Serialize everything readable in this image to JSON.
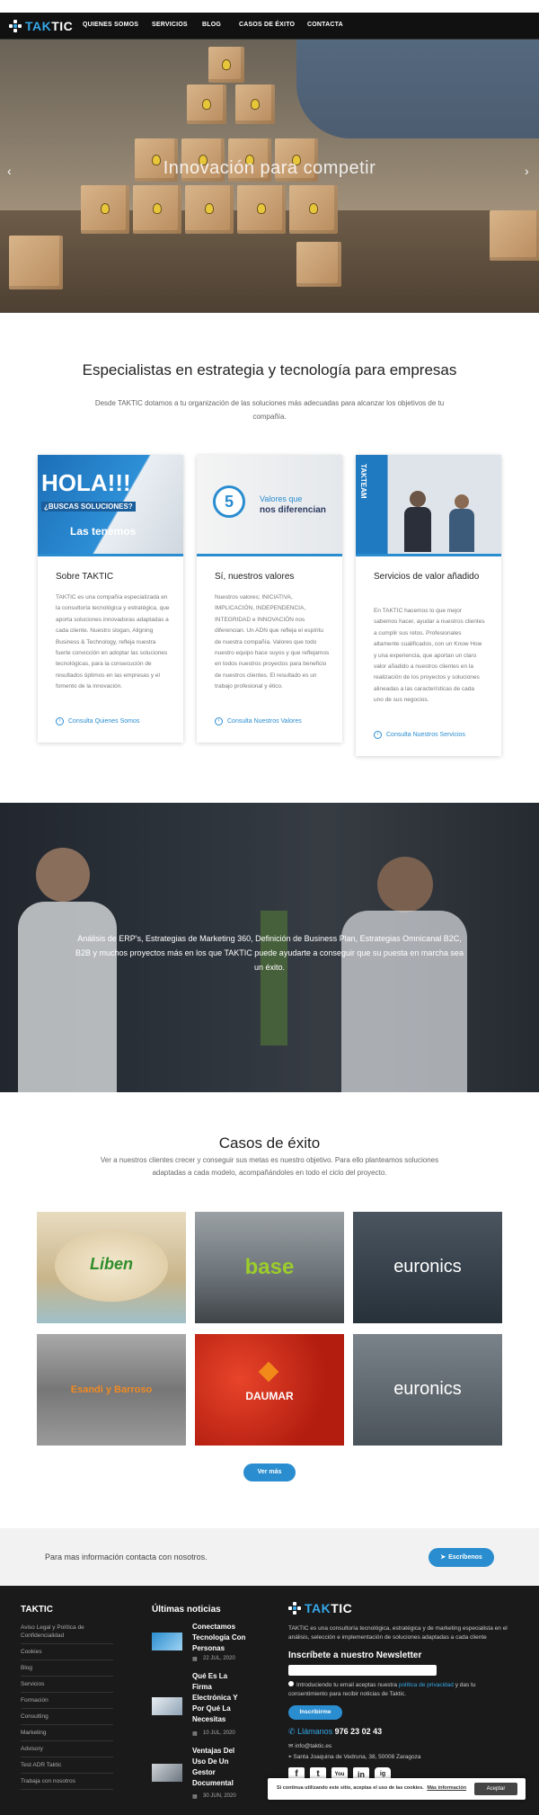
{
  "nav": {
    "brand_a": "TAK",
    "brand_b": "TIC",
    "items": [
      "QUIENES SOMOS",
      "SERVICIOS",
      "BLOG",
      "CASOS DE ÉXITO",
      "CONTACTA"
    ]
  },
  "hero": {
    "title": "Innovación para competir",
    "prev": "‹",
    "next": "›"
  },
  "intro": {
    "title": "Especialistas en estrategia y tecnología para empresas",
    "text": "Desde TAKTIC dotamos a tu organización de las soluciones más adecuadas para alcanzar los objetivos de tu compañía."
  },
  "cards": [
    {
      "img_big": "HOLA!!!",
      "img_mid": "¿BUSCAS SOLUCIONES?",
      "img_small": "Las tenemos",
      "title": "Sobre TAKTIC",
      "text": "TAKTIC es una compañía especializada en la consultoría tecnológica y estratégica, que aporta soluciones innovadoras adaptadas a cada cliente. Nuestro slogan, Aligning Business & Technology, refleja nuestra fuerte convicción en adoptar las soluciones tecnológicas, para la consecución de resultados óptimos en las empresas y el fomento de la innovación.",
      "link": "Consulta Quienes Somos"
    },
    {
      "img_num": "5",
      "img_line1": "Valores que",
      "img_line2": "nos diferencian",
      "title": "Sí, nuestros valores",
      "text": "Nuestros valores; INICIATIVA, IMPLICACIÓN, INDEPENDENCIA, INTEGRIDAD e INNOVACIÓN nos diferencian. Un ADN que refleja el espíritu de nuestra compañía. Valores que todo nuestro equipo hace suyos y que reflejamos en todos nuestros proyectos para beneficio de nuestros clientes. El resultado es un trabajo profesional y ético.",
      "link": "Consulta Nuestros Valores"
    },
    {
      "img_label": "TAKTEAM",
      "title": "Servicios de valor añadido",
      "text": "En TAKTIC hacemos lo que mejor sabemos hacer, ayudar a nuestros clientes a cumplir sus retos. Profesionales altamente cualificados, con un Know How y una experiencia, que aportan un claro valor añadido a nuestros clientes en la realización de los proyectos y soluciones alineadas a las características de cada uno de sus negocios.",
      "link": "Consulta Nuestros Servicios"
    }
  ],
  "banner": {
    "text": "Análisis de ERP's, Estrategias de Marketing 360, Definición de Business Plan, Estrategias Omnicanal B2C, B2B y muchos proyectos más en los que TAKTIC puede ayudarte a conseguir que su puesta en marcha sea un éxito."
  },
  "casos": {
    "title": "Casos de éxito",
    "text": "Ver a nuestros clientes crecer y conseguir sus metas es nuestro objetivo. Para ello planteamos soluciones adaptadas a cada modelo, acompañándoles en todo el ciclo del proyecto.",
    "tiles": [
      "Liben",
      "base",
      "euronics",
      "Esandi y Barroso",
      "DAUMAR",
      "euronics"
    ],
    "tile_subs": [
      "",
      "",
      "",
      "",
      "",
      ""
    ],
    "button": "Ver más"
  },
  "contact": {
    "text": "Para mas información contacta con nosotros.",
    "button": "Escríbenos"
  },
  "footer": {
    "col1_title": "TAKTIC",
    "links": [
      "Aviso Legal y Política de Confidencialidad",
      "Cookies",
      "Blog",
      "Servicios",
      "Formación",
      "Consulting",
      "Marketing",
      "Advisory",
      "Test ADR Taktic",
      "Trabaja con nosotros"
    ],
    "col2_title": "Últimas noticias",
    "news": [
      {
        "title": "Conectamos Tecnología Con Personas",
        "date": "22 JUL, 2020"
      },
      {
        "title": "Qué Es La Firma Electrónica Y Por Qué La Necesitas",
        "date": "10 JUL, 2020"
      },
      {
        "title": "Ventajas Del Uso De Un Gestor Documental",
        "date": "30 JUN, 2020"
      }
    ],
    "brand_a": "TAK",
    "brand_b": "TIC",
    "about": "TAKTIC es una consultoría tecnológica, estratégica y de marketing especialista en el análisis, selección e implementación de soluciones adaptadas a cada cliente",
    "newsletter_title": "Inscríbete a nuestro Newsletter",
    "consent_a": "Introduciendo tu email aceptas nuestra ",
    "consent_link": "política de privacidad",
    "consent_b": " y das tu consentimiento para recibir noticias de Taktic.",
    "subscribe": "Inscribirme",
    "call_label": "Llámanos",
    "phone": "976 23 02 43",
    "email": "info@taktic.es",
    "address": "Santa Joaquina de Vedruna, 38, 50008 Zaragoza",
    "social": [
      "f",
      "t",
      "You",
      "in",
      "ig"
    ]
  },
  "cookie": {
    "text": "Si continua utilizando este sitio, aceptas el uso de las cookies.",
    "link": "Más información",
    "button": "Aceptar"
  },
  "colors": {
    "accent": "#2a8dd0",
    "logo_blue": "#36a8e8",
    "footer_bg": "#1a1a1a"
  }
}
